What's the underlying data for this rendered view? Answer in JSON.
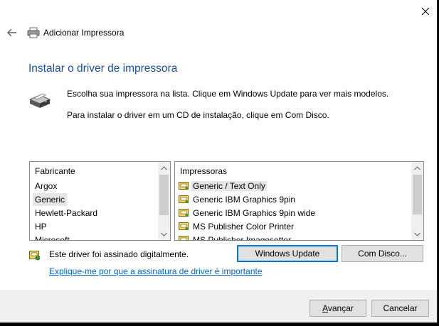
{
  "window": {
    "title": "Adicionar Impressora",
    "close_icon": "close-icon",
    "back_icon": "back-arrow-icon"
  },
  "page": {
    "heading": "Instalar o driver de impressora",
    "instruction_1": "Escolha sua impressora na lista. Clique em Windows Update para ver mais modelos.",
    "instruction_2": "Para instalar o driver em um CD de instalação, clique em Com Disco."
  },
  "manufacturers": {
    "header": "Fabricante",
    "items": [
      "Argox",
      "Generic",
      "Hewlett-Packard",
      "HP",
      "Microsoft"
    ],
    "selected": "Generic"
  },
  "printers": {
    "header": "Impressoras",
    "items": [
      "Generic / Text Only",
      "Generic IBM Graphics 9pin",
      "Generic IBM Graphics 9pin wide",
      "MS Publisher Color Printer",
      "MS Publisher Imagesetter"
    ],
    "selected": "Generic / Text Only"
  },
  "driver": {
    "signed_text": "Este driver foi assinado digitalmente.",
    "link_text": "Explique-me por que a assinatura de driver é importante"
  },
  "buttons": {
    "windows_update": "Windows Update",
    "have_disk": "Com Disco...",
    "next_mnemonic": "A",
    "next_rest": "vançar",
    "cancel": "Cancelar"
  },
  "colors": {
    "heading": "#1b4fa8",
    "link": "#0066cc",
    "default_button_border": "#0078d7",
    "selection": "#e5e5e5"
  }
}
